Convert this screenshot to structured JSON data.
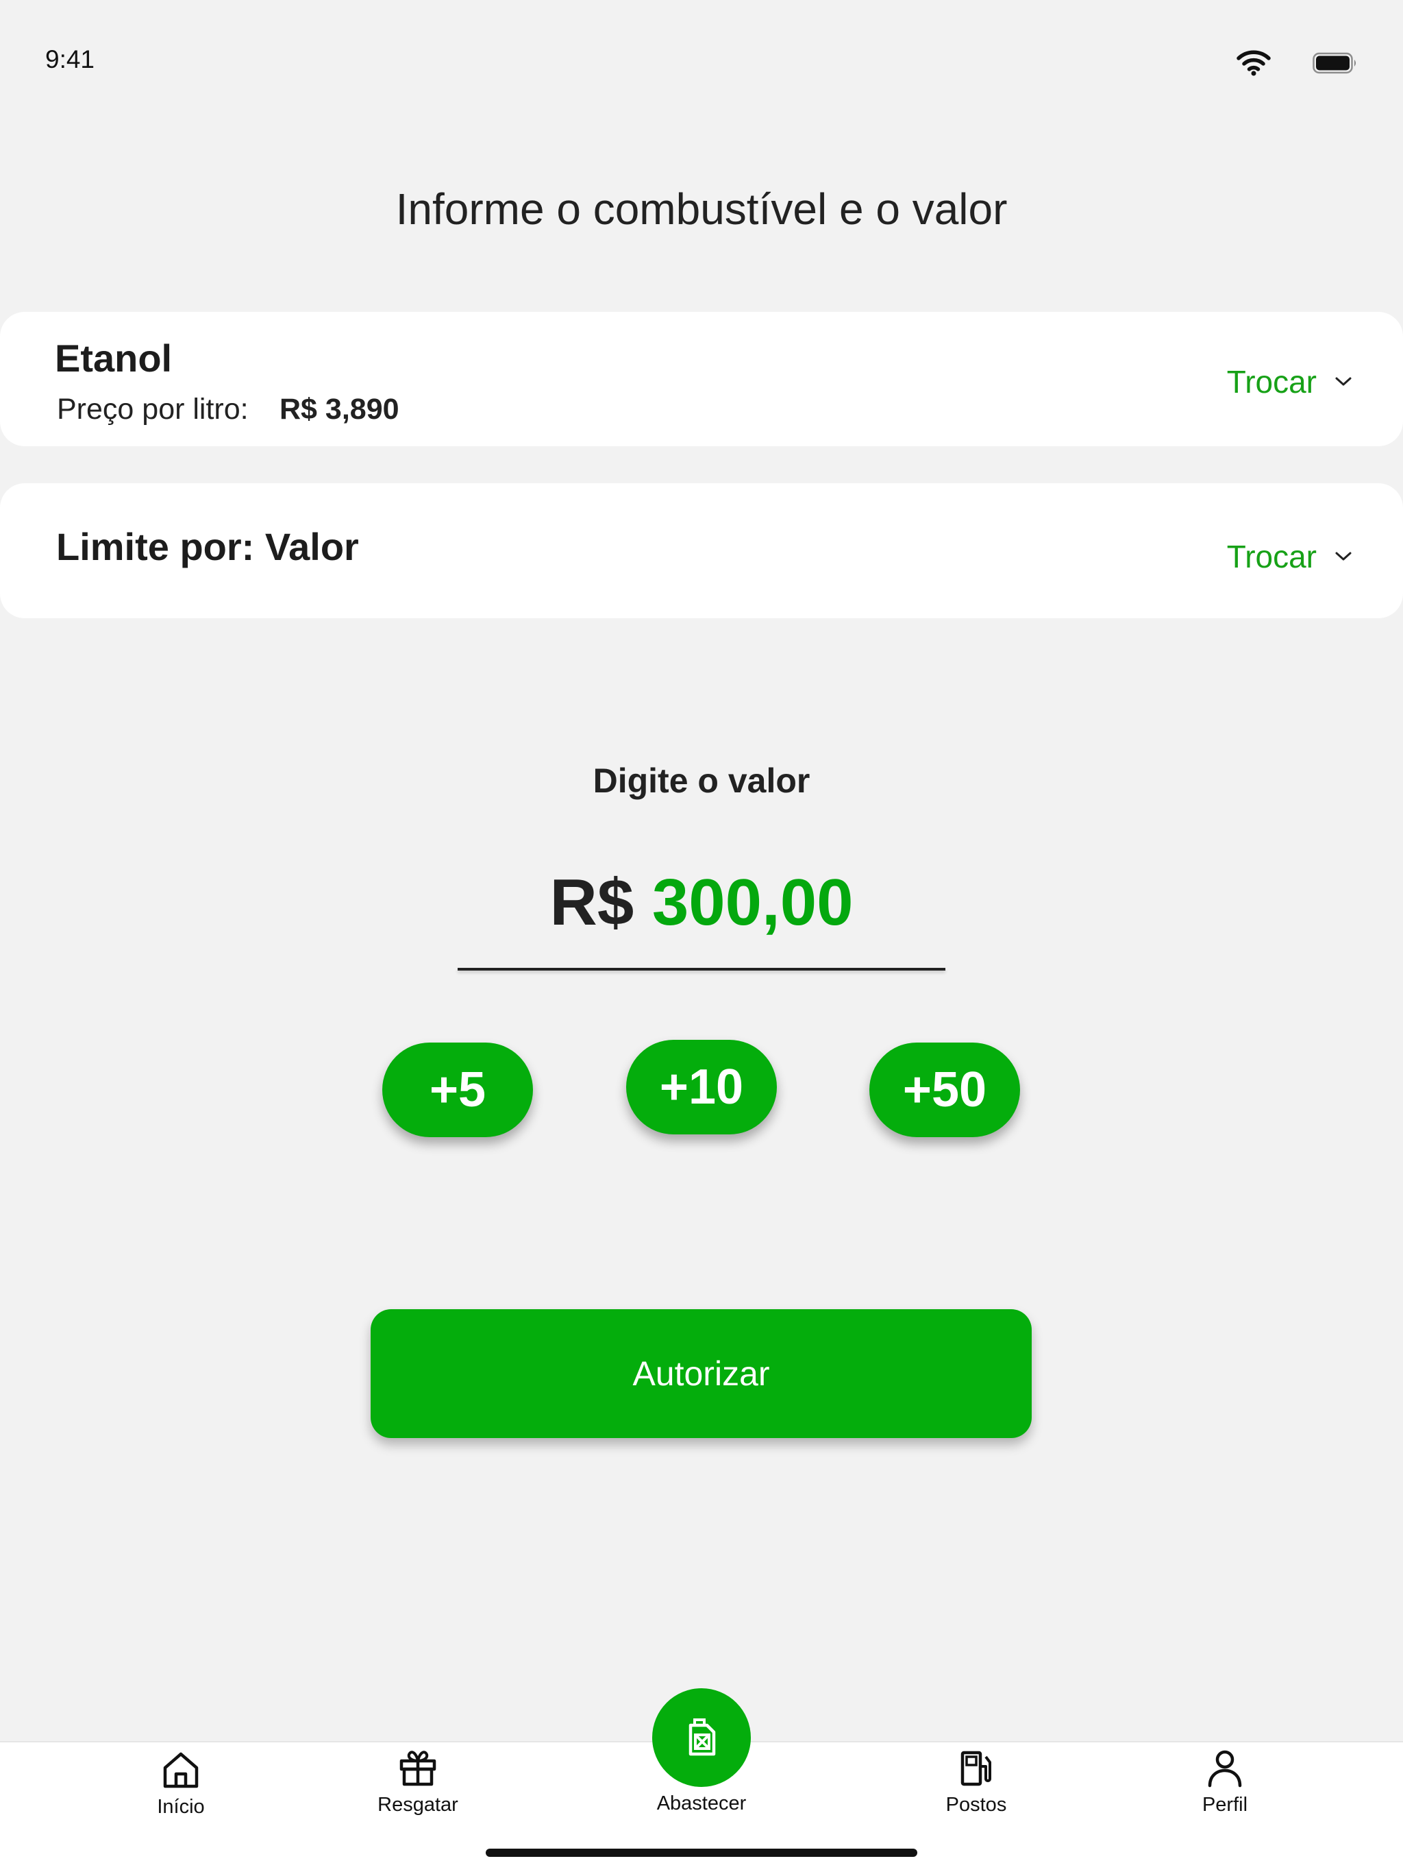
{
  "status_bar": {
    "time": "9:41",
    "icons": [
      "wifi-icon",
      "battery-icon"
    ]
  },
  "page": {
    "title": "Informe o combustível e o valor"
  },
  "fuel_card": {
    "fuel_name": "Etanol",
    "price_label": "Preço por litro:",
    "price_value": "R$ 3,890",
    "change_label": "Trocar"
  },
  "limit_card": {
    "title": "Limite por: Valor",
    "change_label": "Trocar"
  },
  "amount": {
    "label": "Digite o valor",
    "currency": "R$",
    "value": "300,00"
  },
  "increments": [
    "+5",
    "+10",
    "+50"
  ],
  "actions": {
    "authorize_label": "Autorizar"
  },
  "tab_bar": {
    "items": [
      {
        "label": "Início",
        "icon": "home-icon"
      },
      {
        "label": "Resgatar",
        "icon": "gift-icon"
      },
      {
        "label": "Abastecer",
        "icon": "fuel-can-icon",
        "active": true
      },
      {
        "label": "Postos",
        "icon": "gas-station-icon"
      },
      {
        "label": "Perfil",
        "icon": "user-icon"
      }
    ]
  },
  "colors": {
    "accent": "#04AD0C",
    "accent_text": "#17A117",
    "background": "#F2F2F2",
    "card": "#FFFFFF",
    "text": "#222222"
  }
}
